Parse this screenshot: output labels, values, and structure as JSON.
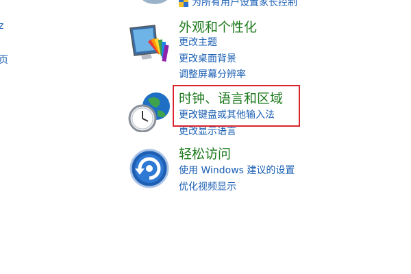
{
  "top_partial_link": "为所有用户设置家长控制",
  "left_fragments": [
    "z",
    "页"
  ],
  "categories": [
    {
      "title": "外观和个性化",
      "icon": "monitor-paint-icon",
      "links": [
        "更改主题",
        "更改桌面背景",
        "调整屏幕分辨率"
      ]
    },
    {
      "title": "时钟、语言和区域",
      "icon": "clock-globe-icon",
      "links": [
        "更改键盘或其他输入法",
        "更改显示语言"
      ]
    },
    {
      "title": "轻松访问",
      "icon": "ease-of-access-icon",
      "links": [
        "使用 Windows 建议的设置",
        "优化视频显示"
      ]
    }
  ],
  "colors": {
    "category_title": "#1e7a1e",
    "link": "#1a5fb4",
    "highlight_box": "#d9232e"
  }
}
